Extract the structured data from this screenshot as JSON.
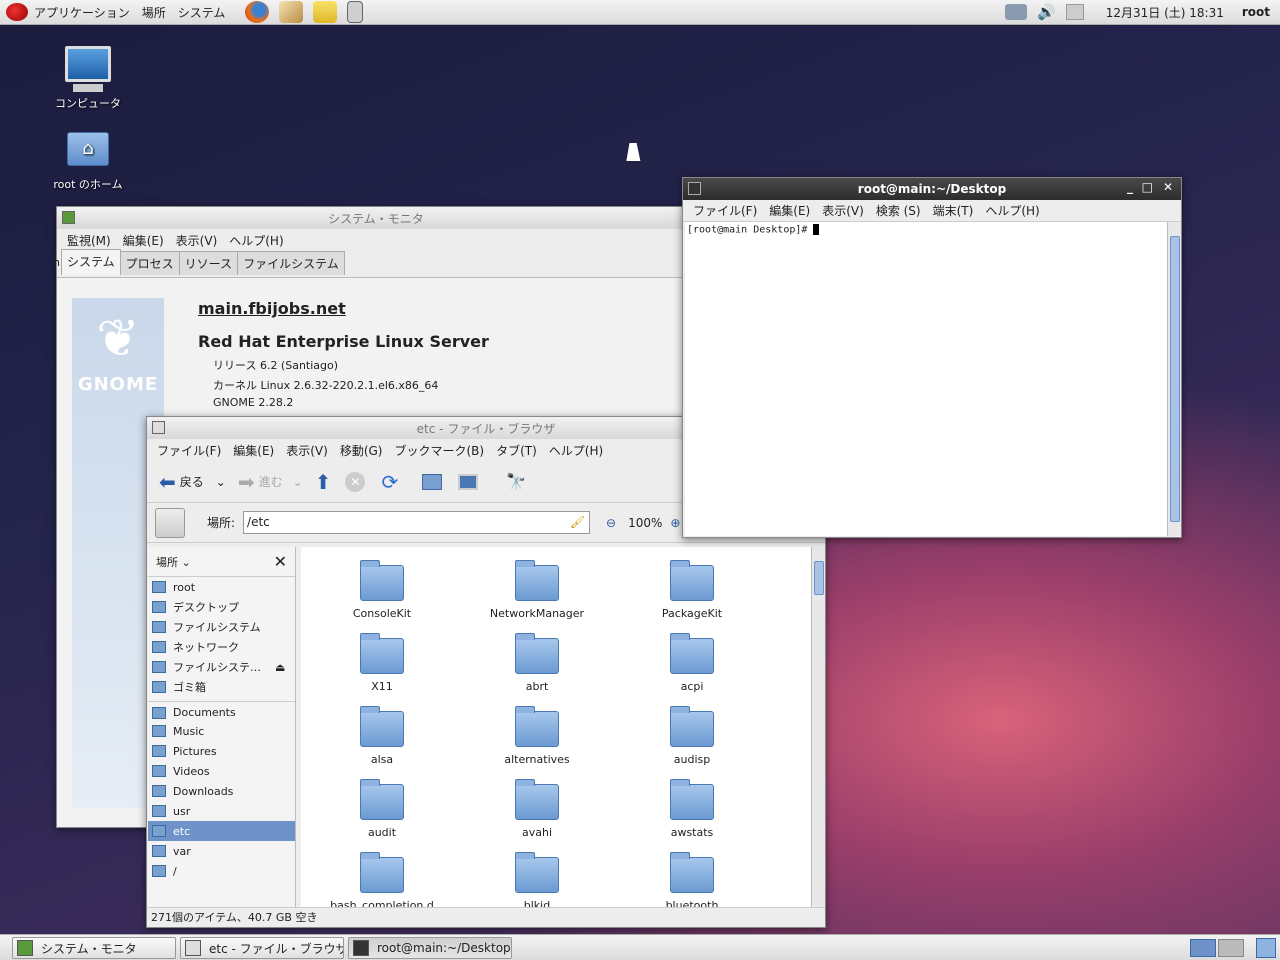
{
  "top_panel": {
    "menus": [
      "アプリケーション",
      "場所",
      "システム"
    ],
    "clock": "12月31日 (土) 18:31",
    "user": "root"
  },
  "desktop_icons": [
    {
      "label": "コンピュータ",
      "icon": "computer-icon"
    },
    {
      "label": "root のホーム",
      "icon": "home-folder-icon"
    }
  ],
  "sysmon": {
    "title": "システム・モニタ",
    "menus": [
      "監視(M)",
      "編集(E)",
      "表示(V)",
      "ヘルプ(H)"
    ],
    "tabs": [
      "システム",
      "プロセス",
      "リソース",
      "ファイルシステム"
    ],
    "hostname": "main.fbijobs.net",
    "os_name": "Red Hat Enterprise Linux Server",
    "release": "リリース 6.2 (Santiago)",
    "kernel": "カーネル Linux 2.6.32-220.2.1.el6.x86_64",
    "gnome": "GNOME 2.28.2",
    "logo_text": "GNOME",
    "side_letter": "h"
  },
  "terminal": {
    "title": "root@main:~/Desktop",
    "menus": [
      "ファイル(F)",
      "編集(E)",
      "表示(V)",
      "検索 (S)",
      "端末(T)",
      "ヘルプ(H)"
    ],
    "prompt": "[root@main Desktop]# "
  },
  "filebrowser": {
    "title": "etc - ファイル・ブラウザ",
    "menus": [
      "ファイル(F)",
      "編集(E)",
      "表示(V)",
      "移動(G)",
      "ブックマーク(B)",
      "タブ(T)",
      "ヘルプ(H)"
    ],
    "back_label": "戻る",
    "forward_label": "進む",
    "location_label": "場所:",
    "location_value": "/etc",
    "zoom": "100%",
    "sidebar_title": "場所",
    "sidebar_items": [
      "root",
      "デスクトップ",
      "ファイルシステム",
      "ネットワーク",
      "ファイルシステ…",
      "ゴミ箱",
      "Documents",
      "Music",
      "Pictures",
      "Videos",
      "Downloads",
      "usr",
      "etc",
      "var",
      "/"
    ],
    "selected_item": "etc",
    "folders": [
      "ConsoleKit",
      "NetworkManager",
      "PackageKit",
      "X11",
      "abrt",
      "acpi",
      "alsa",
      "alternatives",
      "audisp",
      "audit",
      "avahi",
      "awstats",
      "bash_completion.d",
      "blkid",
      "bluetooth"
    ],
    "status": "271個のアイテム、40.7 GB 空き"
  },
  "taskbar": [
    "システム・モニタ",
    "etc - ファイル・ブラウザ",
    "root@main:~/Desktop"
  ]
}
